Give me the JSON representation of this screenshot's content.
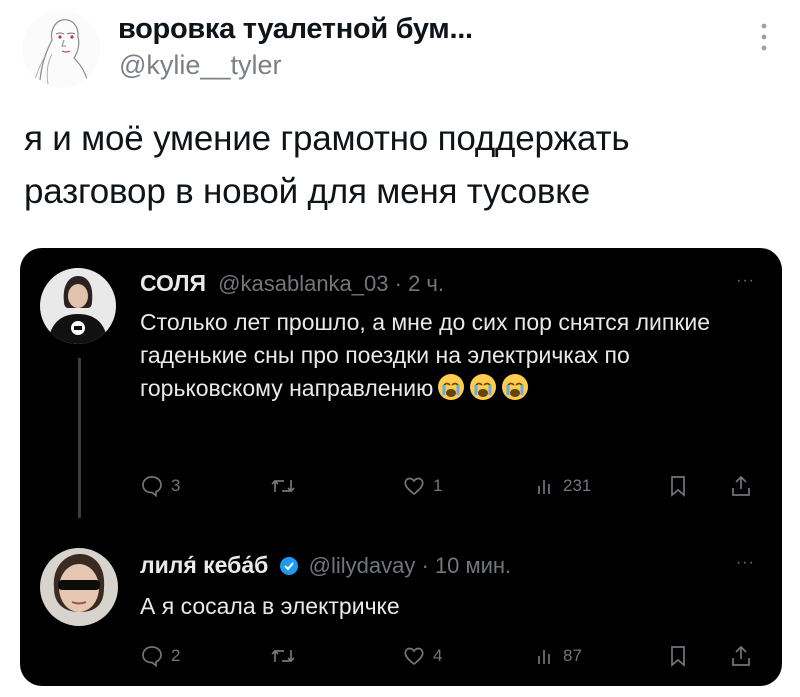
{
  "tweet": {
    "author_name": "воровка туалетной бум...",
    "author_handle": "@kylie__tyler",
    "text": "я и моё умение грамотно поддержать разговор в новой для меня тусовке",
    "more_icon": "vertical-dots-icon"
  },
  "card": {
    "posts": [
      {
        "name": "СОЛЯ",
        "handle": "@kasablanka_03",
        "time": "· 2 ч.",
        "text": "Столько лет прошло, а мне до сих пор снятся липкие гаденькие сны про поездки на электричках по горьковскому направлению",
        "emojis": [
          "crying-face-icon",
          "crying-face-icon",
          "crying-face-icon"
        ],
        "actions": {
          "replies": "3",
          "retweets": "",
          "likes": "1",
          "views": "231"
        }
      },
      {
        "name": "лиля́ кеба́б",
        "verified": true,
        "handle": "@lilydavay",
        "time": "· 10 мин.",
        "text": "А я сосала в электричке",
        "actions": {
          "replies": "2",
          "retweets": "",
          "likes": "4",
          "views": "87"
        }
      }
    ],
    "more_label": "···"
  },
  "colors": {
    "card_bg": "#000000",
    "text_dark": "#0f1419",
    "muted": "#71767b",
    "verified": "#1d9bf0"
  }
}
